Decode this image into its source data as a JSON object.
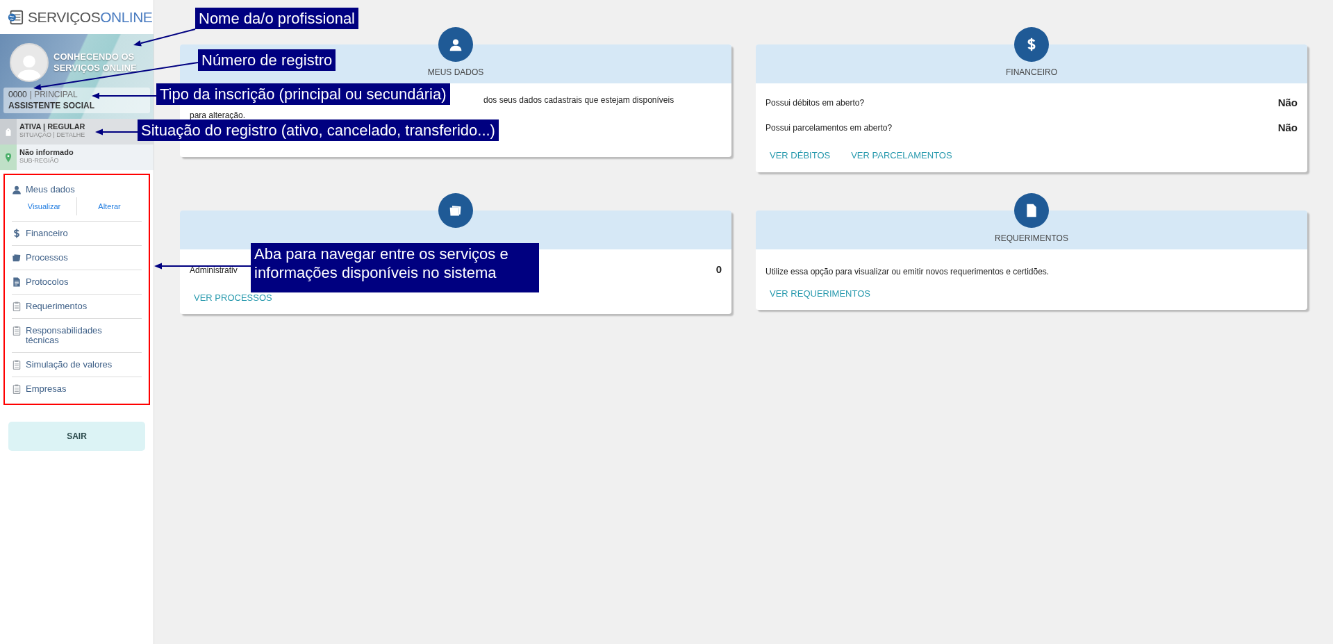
{
  "logo": {
    "brand": "SERVIÇOS",
    "suffix": "ONLINE"
  },
  "profile": {
    "name": "CONHECENDO OS SERVIÇOS ONLINE",
    "registration": "0000",
    "type": "| PRINCIPAL",
    "profession": "ASSISTENTE SOCIAL"
  },
  "status": {
    "value": "ATIVA | REGULAR",
    "caption": "SITUAÇÃO | DETALHE"
  },
  "region": {
    "value": "Não informado",
    "caption": "SUB-REGIÃO"
  },
  "menu": [
    {
      "label": "Meus dados",
      "kind": "user",
      "links": [
        "Visualizar",
        "Alterar"
      ]
    },
    {
      "label": "Financeiro",
      "kind": "money"
    },
    {
      "label": "Processos",
      "kind": "folder"
    },
    {
      "label": "Protocolos",
      "kind": "doc"
    },
    {
      "label": "Requerimentos",
      "kind": "clipboard"
    },
    {
      "label": "Responsabilidades técnicas",
      "kind": "clipboard"
    },
    {
      "label": "Simulação de valores",
      "kind": "clipboard"
    },
    {
      "label": "Empresas",
      "kind": "clipboard"
    }
  ],
  "logout": "SAIR",
  "card_rows": [
    {
      "cards": [
        {
          "title": "MEUS DADOS",
          "kind": "user",
          "lines": [
            "dos seus dados cadastrais que estejam disponíveis",
            "para alteração."
          ]
        },
        {
          "title": "FINANCEIRO",
          "kind": "money",
          "rows": [
            {
              "label": "Possui débitos em aberto?",
              "value": "Não"
            },
            {
              "label": "Possui parcelamentos em aberto?",
              "value": "Não"
            }
          ],
          "links": [
            "VER DÉBITOS",
            "VER PARCELAMENTOS"
          ]
        }
      ]
    },
    {
      "cards": [
        {
          "kind": "folder",
          "rows": [
            {
              "label": "Administrativ",
              "value": "0"
            }
          ],
          "links": [
            "VER PROCESSOS"
          ]
        },
        {
          "title": "REQUERIMENTOS",
          "kind": "doc",
          "text": "Utilize essa opção para visualizar ou emitir novos requerimentos e certidões.",
          "links": [
            "VER REQUERIMENTOS"
          ]
        }
      ]
    }
  ],
  "annotations": [
    {
      "text": "Nome da/o profissional"
    },
    {
      "text": "Número de registro"
    },
    {
      "text": "Tipo da inscrição (principal ou secundária)"
    },
    {
      "text": "Situação do registro (ativo, cancelado, transferido...)"
    },
    {
      "text": "Aba para navegar entre os serviços e informações disponíveis no sistema"
    }
  ]
}
